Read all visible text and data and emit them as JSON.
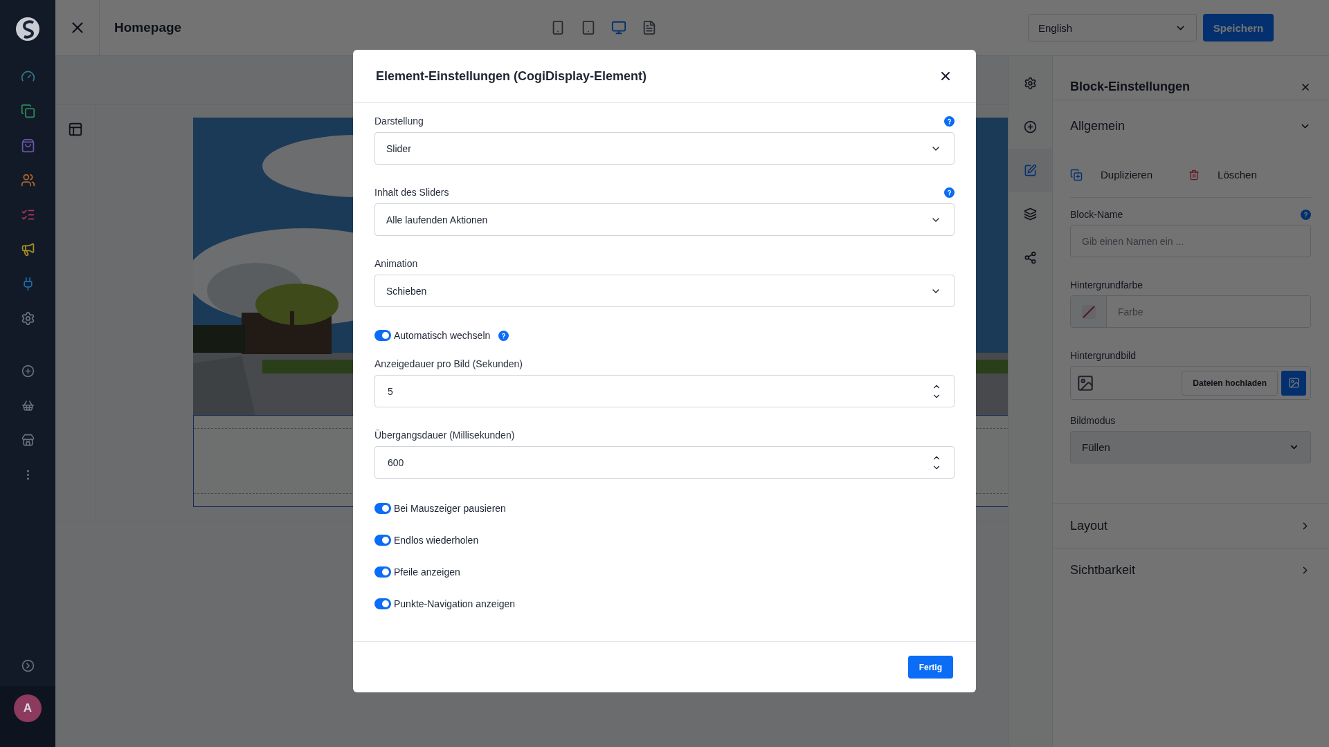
{
  "sidebar": {
    "nav": [
      {
        "color": "#2e7a86"
      },
      {
        "color": "#2f8a5c"
      },
      {
        "color": "#6a56a8"
      },
      {
        "color": "#b0652e"
      },
      {
        "color": "#a83560"
      },
      {
        "color": "#a8921a"
      },
      {
        "color": "#1a6fae"
      },
      {
        "color": "#6b7280"
      }
    ],
    "avatar": "A"
  },
  "topbar": {
    "title": "Homepage",
    "devices": [
      {
        "selected": false
      },
      {
        "selected": false
      },
      {
        "selected": true
      },
      {
        "selected": false
      }
    ],
    "language": "English",
    "save": "Speichern"
  },
  "rail": [
    {
      "selected": false
    },
    {
      "selected": false
    },
    {
      "selected": true
    },
    {
      "selected": false
    },
    {
      "selected": false
    }
  ],
  "panel": {
    "title": "Block-Einstellungen",
    "sections": [
      {
        "title": "Allgemein",
        "expanded": true
      },
      {
        "title": "Layout",
        "expanded": false
      },
      {
        "title": "Sichtbarkeit",
        "expanded": false
      }
    ],
    "actions": [
      "Duplizieren",
      "Löschen"
    ],
    "block_name": {
      "label": "Block-Name",
      "placeholder": "Gib einen Namen ein ..."
    },
    "background_color": {
      "label": "Hintergrundfarbe",
      "placeholder": "Farbe"
    },
    "background_image": {
      "label": "Hintergrundbild",
      "upload": "Dateien hochladen"
    },
    "image_mode": {
      "label": "Bildmodus",
      "value": "Füllen"
    }
  },
  "modal": {
    "title": "Element-Einstellungen (CogiDisplay-Element)",
    "fields": [
      {
        "kind": "select",
        "label": "Darstellung",
        "value": "Slider",
        "help": true
      },
      {
        "kind": "select",
        "label": "Inhalt des Sliders",
        "value": "Alle laufenden Aktionen",
        "help": true
      },
      {
        "kind": "select",
        "label": "Animation",
        "value": "Schieben",
        "help": false
      },
      {
        "kind": "toggle",
        "label": "Automatisch wechseln",
        "on": true,
        "help": true
      },
      {
        "kind": "number",
        "label": "Anzeigedauer pro Bild (Sekunden)",
        "value": "5"
      },
      {
        "kind": "number",
        "label": "Übergangsdauer (Millisekunden)",
        "value": "600"
      },
      {
        "kind": "toggle",
        "label": "Bei Mauszeiger pausieren",
        "on": true,
        "help": false
      },
      {
        "kind": "toggle",
        "label": "Endlos wiederholen",
        "on": true,
        "help": false
      },
      {
        "kind": "toggle",
        "label": "Pfeile anzeigen",
        "on": true,
        "help": false
      },
      {
        "kind": "toggle",
        "label": "Punkte-Navigation anzeigen",
        "on": true,
        "help": false
      }
    ],
    "done": "Fertig"
  }
}
